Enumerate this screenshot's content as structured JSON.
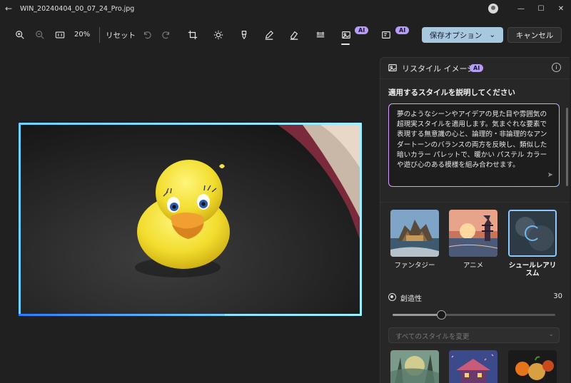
{
  "window": {
    "title": "WIN_20240404_00_07_24_Pro.jpg",
    "back": "←",
    "minimize": "—",
    "maximize": "☐",
    "close": "✕"
  },
  "toolbar": {
    "zoom": "20%",
    "reset": "リセット",
    "ai_badge_1": "AI",
    "ai_badge_2": "AI",
    "save": "保存オプション",
    "save_chevron": "⌄",
    "cancel": "キャンセル"
  },
  "panel": {
    "title": "リスタイル イメージ",
    "ai_badge": "AI",
    "info": "i",
    "subheading": "適用するスタイルを説明してください",
    "prompt": "夢のようなシーンやアイデアの見た目や雰囲気の超現実スタイルを適用します。気まぐれな要素で表現する無意識の心と、論理的・非論理的なアンダートーンのバランスの両方を反映し、類似した暗いカラー パレットで、暖かい パステル カラーや遊び心のある模様を組み合わせます。",
    "send": "➤",
    "styles": [
      {
        "label": "ファンタジー",
        "selected": false
      },
      {
        "label": "アニメ",
        "selected": false
      },
      {
        "label": "シュールレアリスム",
        "selected": true
      }
    ],
    "creativity": {
      "label": "創造性",
      "value": "30",
      "fraction": 0.3
    },
    "dropdown_placeholder": "すべてのスタイルを変更",
    "dropdown_chevron": "⌄"
  },
  "colors": {
    "accent": "#a8c8e0",
    "ai_badge": "#b79cf7",
    "frame": "#6ed1ff"
  }
}
